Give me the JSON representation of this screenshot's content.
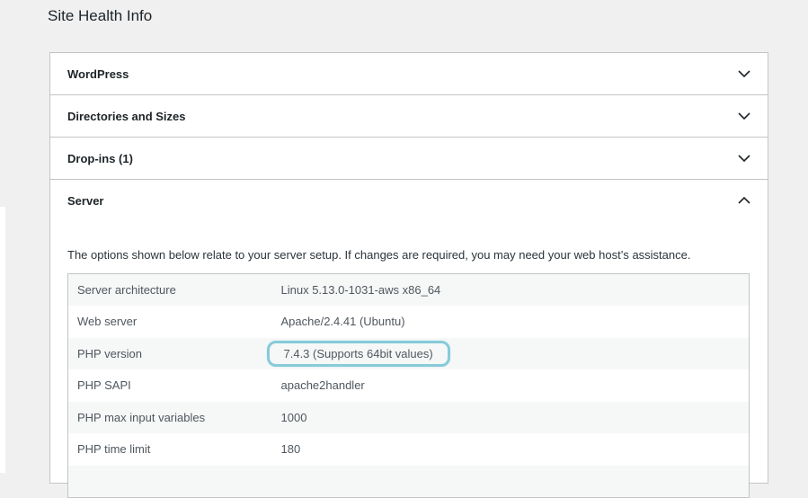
{
  "page": {
    "title": "Site Health Info"
  },
  "sections": [
    {
      "title": "WordPress",
      "expanded": false
    },
    {
      "title": "Directories and Sizes",
      "expanded": false
    },
    {
      "title": "Drop-ins (1)",
      "expanded": false
    },
    {
      "title": "Server",
      "expanded": true
    }
  ],
  "server": {
    "description": "The options shown below relate to your server setup. If changes are required, you may need your web host’s assistance.",
    "rows": [
      {
        "label": "Server architecture",
        "value": "Linux 5.13.0-1031-aws x86_64"
      },
      {
        "label": "Web server",
        "value": "Apache/2.4.41 (Ubuntu)"
      },
      {
        "label": "PHP version",
        "value": "7.4.3 (Supports 64bit values)",
        "highlighted": true
      },
      {
        "label": "PHP SAPI",
        "value": "apache2handler"
      },
      {
        "label": "PHP max input variables",
        "value": "1000"
      },
      {
        "label": "PHP time limit",
        "value": "180"
      }
    ]
  },
  "icons": {
    "collapsed": "chevron-down-icon",
    "expanded": "chevron-up-icon"
  },
  "colors": {
    "highlight_outline": "#86cbd9",
    "border": "#c3c4c7"
  }
}
